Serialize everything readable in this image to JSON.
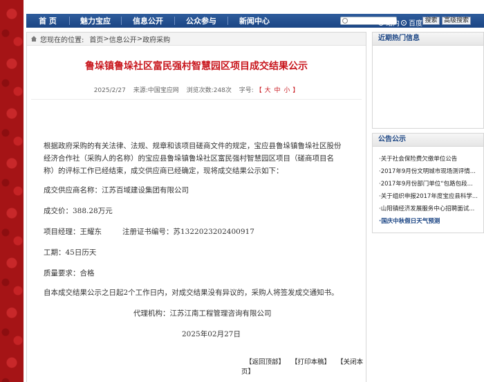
{
  "nav": {
    "items": [
      "首 页",
      "魅力宝应",
      "信息公开",
      "公众参与",
      "新闻中心"
    ],
    "search_placeholder": "",
    "radio_site": "站内",
    "radio_baidu": "百度",
    "search_button": "搜索",
    "advanced_button": "高级搜索"
  },
  "breadcrumb": {
    "prefix": "您现在的位置:",
    "home": "首页",
    "sep1": " > ",
    "level1": "信息公开",
    "sep2": " > ",
    "level2": "政府采购"
  },
  "article": {
    "title": "鲁垛镇鲁垛社区富民强村智慧园区项目成交结果公示",
    "date": "2025/2/27",
    "source_label": "来源:",
    "source": "中国宝应网",
    "views_label": "浏览次数:",
    "views": "248次",
    "font_label": "字号:",
    "font_open": "【",
    "font_large": "大",
    "font_medium": "中",
    "font_small": "小",
    "font_close": "】",
    "intro_line1": "根据政府采购的有关法律、法规、规章和该项目磋商文件的规定，宝应县鲁垛镇鲁垛社区股份",
    "intro_line2": "经济合作社（采购人的名称）的宝应县鲁垛镇鲁垛社区富民强村智慧园区项目（磋商项目名",
    "intro_line3": "称）的评标工作已经结束，成交供应商已经确定，现将成交结果公示如下：",
    "supplier": "成交供应商名称：江苏百域建设集团有限公司",
    "price": "成交价：388.28万元",
    "manager": "项目经理：王耀东",
    "cert": "注册证书编号：苏1322023202400917",
    "period": "工期：45日历天",
    "quality": "质量要求：合格",
    "notice": "自本成交结果公示之日起2个工作日内，对成交结果没有异议的，采购人将签发成交通知书。",
    "agency": "代理机构：江苏江南工程管理咨询有限公司",
    "sign_date": "2025年02月27日",
    "link_top": "【返回顶部】",
    "link_print": "【打印本稿】",
    "link_close": "【关闭本页】"
  },
  "sidebar": {
    "hot_title": "近期热门信息",
    "notice_title": "公告公示",
    "notices": [
      "·关于社会保险费欠缴单位公告",
      "·2017年9月份文明城市现场测评情...",
      "·2017年9月份部门单位“包路包段...",
      "·关于组织申报2017年度宝应县科学...",
      "·山阳镇经济发展服务中心招聘面试...",
      "·国庆中秋假日天气预测"
    ]
  }
}
